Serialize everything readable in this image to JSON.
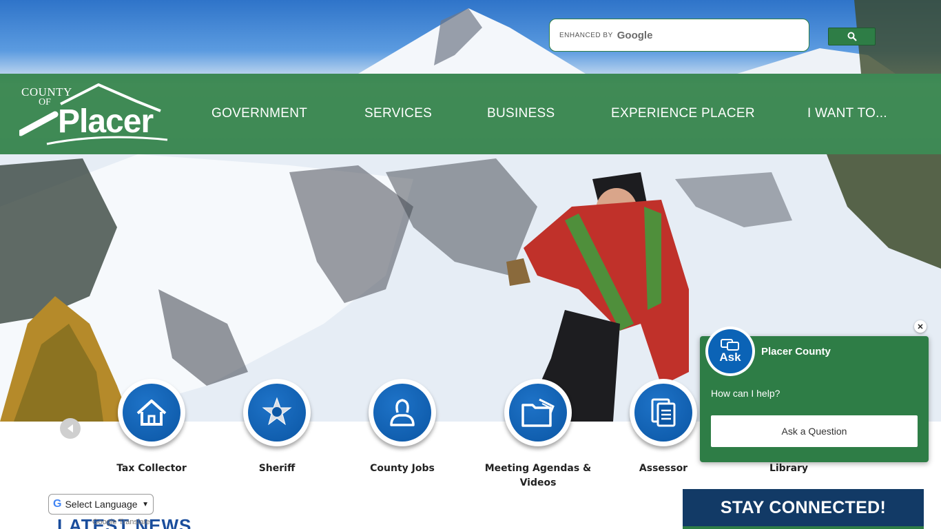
{
  "search": {
    "enhanced_label": "ENHANCED BY",
    "google_label": "Google",
    "button_icon": "search-icon"
  },
  "logo": {
    "county": "COUNTY",
    "of": "OF",
    "name": "Placer"
  },
  "nav": {
    "items": [
      {
        "label": "GOVERNMENT"
      },
      {
        "label": "SERVICES"
      },
      {
        "label": "BUSINESS"
      },
      {
        "label": "EXPERIENCE PLACER"
      },
      {
        "label": "I WANT TO..."
      }
    ]
  },
  "quick_links": [
    {
      "label": "Tax Collector",
      "icon": "home-icon"
    },
    {
      "label": "Sheriff",
      "icon": "sheriff-badge-icon"
    },
    {
      "label": "County Jobs",
      "icon": "person-icon"
    },
    {
      "label": "Meeting Agendas & Videos",
      "icon": "folder-icon"
    },
    {
      "label": "Assessor",
      "icon": "documents-icon"
    },
    {
      "label": "Library",
      "icon": "book-icon"
    }
  ],
  "translate": {
    "label": "Select Language",
    "powered": "Google Translate"
  },
  "latest_news": "LATEST NEWS",
  "chat": {
    "avatar_label": "Ask",
    "title": "Placer County",
    "prompt": "How can I help?",
    "button": "Ask a Question"
  },
  "stay_connected": "STAY CONNECTED!",
  "colors": {
    "green": "#2e7d46",
    "blue": "#0b56a4",
    "navy": "#123a66"
  }
}
